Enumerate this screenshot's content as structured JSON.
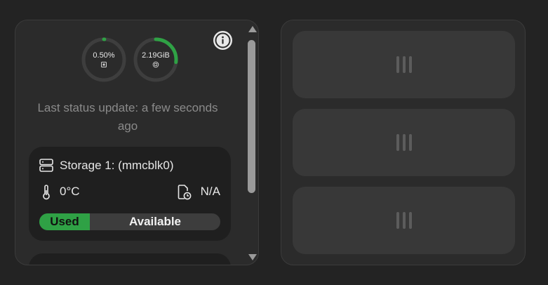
{
  "left_panel": {
    "gauges": [
      {
        "value": "0.50%",
        "fraction": 0.005,
        "icon": "cpu-icon",
        "color": "#2fa145"
      },
      {
        "value": "2.19GiB",
        "fraction": 0.27,
        "icon": "memory-icon",
        "color": "#2fa145"
      }
    ],
    "info_icon": "info-icon",
    "status_text": "Last status update: a few seconds ago",
    "storage": {
      "title": "Storage 1: (mmcblk0)",
      "temperature": "0°C",
      "time_value": "N/A",
      "used_label": "Used",
      "available_label": "Available",
      "used_fraction": 0.28
    }
  },
  "right_panel": {
    "slots": [
      {
        "icon": "drag-handle-icon"
      },
      {
        "icon": "drag-handle-icon"
      },
      {
        "icon": "drag-handle-icon"
      }
    ]
  },
  "colors": {
    "accent": "#2fa145",
    "background": "#232323",
    "panel": "#2b2b2b"
  }
}
